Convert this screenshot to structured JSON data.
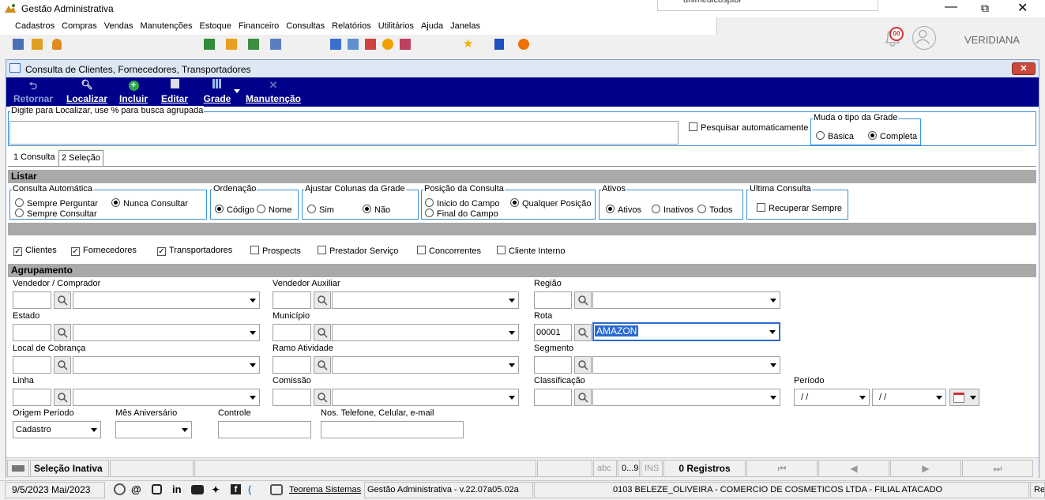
{
  "app": {
    "title": "Gestão Administrativa",
    "notif_text": "unimedicospibr",
    "notif_badge": "00",
    "user": "VERIDIANA"
  },
  "menu": [
    "Cadastros",
    "Compras",
    "Vendas",
    "Manutenções",
    "Estoque",
    "Financeiro",
    "Consultas",
    "Relatórios",
    "Utilitários",
    "Ajuda",
    "Janelas"
  ],
  "window": {
    "title": "Consulta de Clientes, Fornecedores, Transportadores"
  },
  "toolbar": {
    "retornar": "Retornar",
    "localizar": "Localizar",
    "incluir": "Incluir",
    "editar": "Editar",
    "grade": "Grade",
    "manutencao": "Manutenção"
  },
  "search": {
    "label": "Digite para Localizar, use % para busca agrupada",
    "value": "",
    "auto_label": "Pesquisar automaticamente",
    "grid_type_title": "Muda o tipo da Grade",
    "basica": "Básica",
    "completa": "Completa"
  },
  "tabs": [
    "1 Consulta",
    "2 Seleção"
  ],
  "listar": {
    "title": "Listar",
    "consulta_auto": {
      "title": "Consulta Automática",
      "opt1": "Sempre Perguntar",
      "opt2": "Nunca Consultar",
      "opt3": "Sempre Consultar"
    },
    "ordenacao": {
      "title": "Ordenação",
      "opt1": "Código",
      "opt2": "Nome"
    },
    "ajustar": {
      "title": "Ajustar Colunas da Grade",
      "opt1": "Sim",
      "opt2": "Não"
    },
    "posicao": {
      "title": "Posição da Consulta",
      "opt1": "Inicio do Campo",
      "opt2": "Qualquer Posição",
      "opt3": "Final do Campo"
    },
    "ativos": {
      "title": "Ativos",
      "opt1": "Ativos",
      "opt2": "Inativos",
      "opt3": "Todos"
    },
    "ultima": {
      "title": "Ultima Consulta",
      "opt1": "Recuperar Sempre"
    }
  },
  "tipos": [
    {
      "label": "Clientes",
      "checked": true
    },
    {
      "label": "Fornecedores",
      "checked": true
    },
    {
      "label": "Transportadores",
      "checked": true
    },
    {
      "label": "Prospects",
      "checked": false
    },
    {
      "label": "Prestador Serviço",
      "checked": false
    },
    {
      "label": "Concorrentes",
      "checked": false
    },
    {
      "label": "Cliente Interno",
      "checked": false
    }
  ],
  "agrupamento": {
    "title": "Agrupamento",
    "vendedor": "Vendedor / Comprador",
    "vendedor_aux": "Vendedor Auxiliar",
    "regiao": "Região",
    "estado": "Estado",
    "municipio": "Município",
    "rota": "Rota",
    "rota_code": "00001",
    "rota_value": "AMAZON",
    "local_cobranca": "Local de Cobrança",
    "ramo": "Ramo Atividade",
    "segmento": "Segmento",
    "linha": "Linha",
    "comissao": "Comissão",
    "classificacao": "Classificação",
    "periodo": "Período",
    "periodo_de": "/ /",
    "periodo_ate": "/ /",
    "origem": "Origem Período",
    "origem_value": "Cadastro",
    "mes_aniv": "Mês Aniversário",
    "controle": "Controle",
    "nos_tel": "Nos. Telefone, Celular, e-mail"
  },
  "status": {
    "selecao": "Seleção Inativa",
    "abc": "abc",
    "num": "0...9",
    "ins": "INS",
    "registros": "0 Registros"
  },
  "footer": {
    "date": "9/5/2023 Mai/2023",
    "link": "Teorema Sistemas",
    "version": "Gestão Administrativa - v.22.07a05.02a",
    "company": "0103 BELEZE_OLIVEIRA - COMERCIO DE COSMETICOS LTDA - FILIAL ATACADO",
    "trailing": "Re"
  },
  "colors": {
    "toolbar_bg": "#00008b",
    "accent": "#3a8fd6",
    "title_bar": "#cfe0f2"
  }
}
